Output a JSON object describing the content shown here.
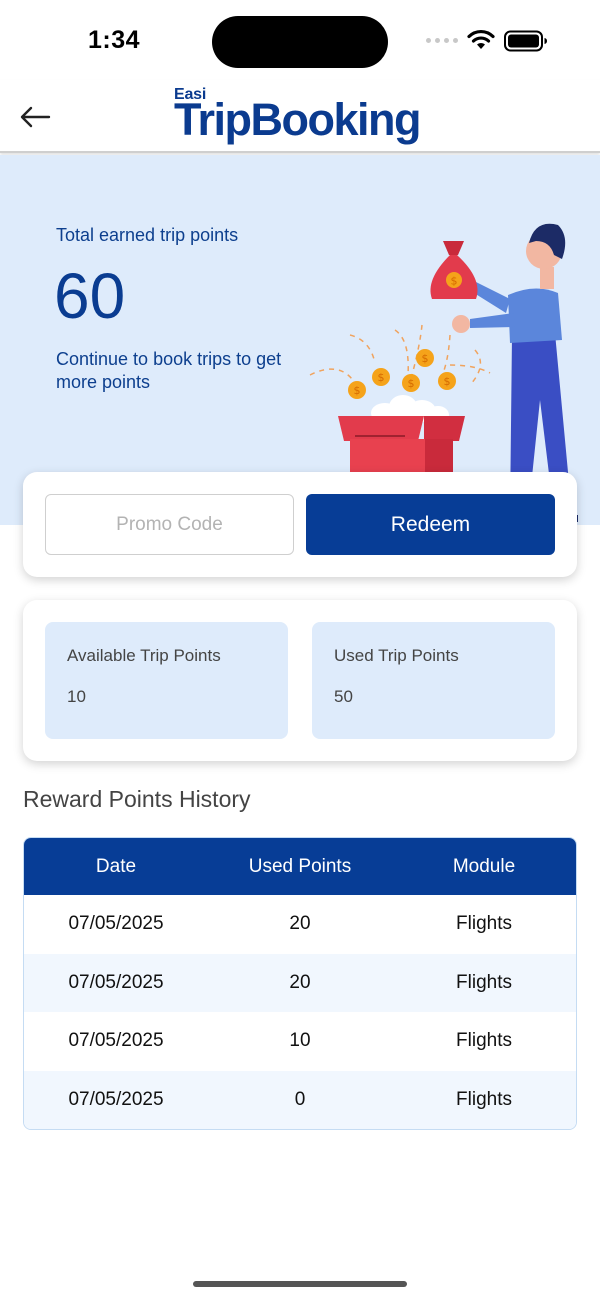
{
  "status_bar": {
    "time": "1:34",
    "icons": [
      "signal-dots-icon",
      "wifi-icon",
      "battery-icon"
    ]
  },
  "header": {
    "back_icon": "arrow-left-icon",
    "logo_small": "Easi",
    "logo_main": "TripBooking",
    "brand_color": "#0b3b8f"
  },
  "hero": {
    "label": "Total earned trip points",
    "points": "60",
    "caption": "Continue to book trips to get more points",
    "background": "#deebfb"
  },
  "promo": {
    "placeholder": "Promo Code",
    "value": "",
    "redeem_label": "Redeem",
    "button_color": "#073d96"
  },
  "points_summary": {
    "available_label": "Available Trip Points",
    "available_value": "10",
    "used_label": "Used Trip Points",
    "used_value": "50"
  },
  "history": {
    "title": "Reward Points History",
    "columns": [
      "Date",
      "Used Points",
      "Module"
    ],
    "rows": [
      [
        "07/05/2025",
        "20",
        "Flights"
      ],
      [
        "07/05/2025",
        "20",
        "Flights"
      ],
      [
        "07/05/2025",
        "10",
        "Flights"
      ],
      [
        "07/05/2025",
        "0",
        "Flights"
      ]
    ]
  }
}
